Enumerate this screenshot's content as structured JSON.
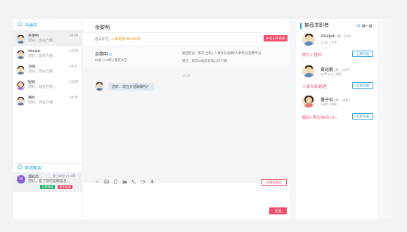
{
  "left": {
    "header": "沟通中",
    "chats": [
      {
        "name": "余黎明",
        "msg": "您好，现在方便...",
        "time": "14:29"
      },
      {
        "name": "zhuojun",
        "msg": "您好，现在方便...",
        "time": "14:28"
      },
      {
        "name": "汤姆",
        "msg": "您好，现在方便...",
        "time": "14:27"
      },
      {
        "name": "妮妮",
        "msg": "您好，现在方便...",
        "time": "14:26"
      },
      {
        "name": "魏跃",
        "msg": "您好，现在方便...",
        "time": "14:25"
      }
    ],
    "notice_header": "申请面谈",
    "notice": {
      "icon_char": "m",
      "name": "郭彩鸿",
      "meta": "女 | 30岁 | 1-3年",
      "msg": "您好，看了您的招聘信息...",
      "accept": "立即面谈",
      "reject": "暂不面谈"
    }
  },
  "center": {
    "title": "余黎明",
    "sub_label": "面试职位:",
    "sub_job": "人事专员",
    "sub_salary": "4K-6K/月",
    "warn_label": "标记不合适",
    "profile": {
      "name": "余黎明",
      "ok_mark": "◎",
      "info": "23岁 | 1-3年 | 南京大学",
      "right1": "期望职位：南京-全职 | 人事专员/招聘/人事专员/招聘专员",
      "right2": "现任：南京xx科技有限公司 行政"
    },
    "msg_time": "14:29",
    "bubble": "您好，现在方便聊聊吗？",
    "report_label": "向我投简历",
    "send_label": "发送"
  },
  "right": {
    "title": "推荐求职者",
    "refresh": "换一批",
    "recs": [
      {
        "name": "zhuojun",
        "meta": "(男，25岁)",
        "info": "1-3年 | 大专",
        "job": "软件工程师",
        "btn": "立即沟通"
      },
      {
        "name": "黄裕鹏",
        "meta": "(男，45岁)",
        "info": "10年以上 | 硕士",
        "job": "人事专员/助理",
        "btn": "立即沟通"
      },
      {
        "name": "曹子怡",
        "meta": "(女，26岁)",
        "info": "3-5年 | 高中",
        "job": "解说+导乐/休闲+计...",
        "btn": "立即沟通"
      }
    ]
  },
  "icons": {
    "chat": "chat-bubble-icon",
    "notice": "clock-icon",
    "refresh": "refresh-icon",
    "warn": "close-circle-icon",
    "toolbar": [
      "emoji-icon",
      "image-icon",
      "phone-icon",
      "folder-icon",
      "call-icon",
      "video-icon",
      "mic-icon"
    ]
  },
  "colors": {
    "accent": "#2ea0df",
    "danger": "#f0506e",
    "success": "#27b36b",
    "warning": "#f08a00"
  }
}
